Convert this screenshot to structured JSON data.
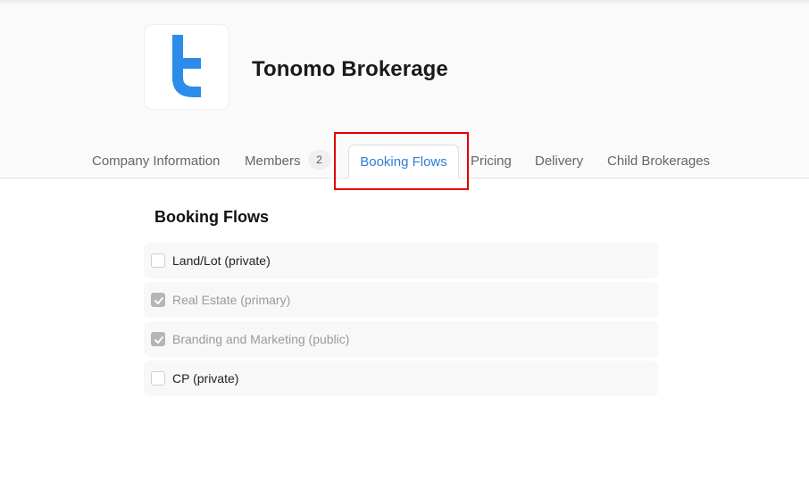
{
  "company": {
    "name": "Tonomo Brokerage",
    "logo_icon": "tonomo-t-logo",
    "brand_color": "#2d8ceb"
  },
  "tabs": [
    {
      "label": "Company Information",
      "active": false
    },
    {
      "label": "Members",
      "badge": "2",
      "active": false
    },
    {
      "label": "Booking Flows",
      "active": true
    },
    {
      "label": "Pricing",
      "active": false
    },
    {
      "label": "Delivery",
      "active": false
    },
    {
      "label": "Child Brokerages",
      "active": false
    }
  ],
  "booking_flows": {
    "title": "Booking Flows",
    "items": [
      {
        "label": "Land/Lot (private)",
        "checked": false,
        "disabled": false
      },
      {
        "label": "Real Estate (primary)",
        "checked": true,
        "disabled": true
      },
      {
        "label": "Branding and Marketing (public)",
        "checked": true,
        "disabled": true
      },
      {
        "label": "CP (private)",
        "checked": false,
        "disabled": false
      }
    ]
  },
  "colors": {
    "active_tab": "#2d7ed8",
    "highlight": "#e30000"
  }
}
